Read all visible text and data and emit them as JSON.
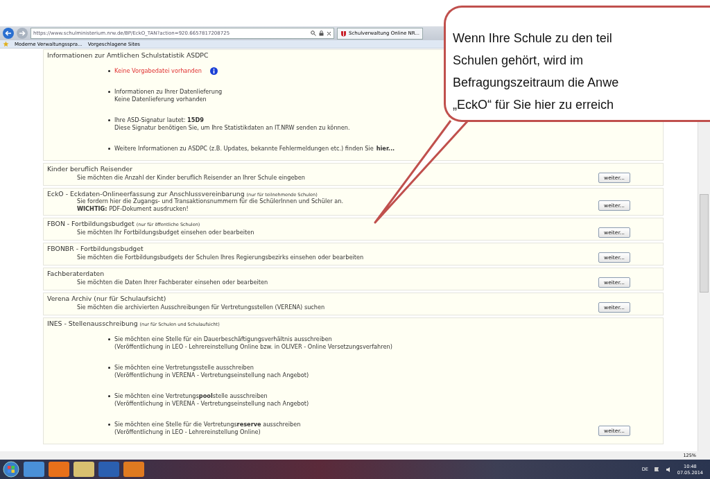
{
  "browser": {
    "url": "https://www.schulministerium.nrw.de/BP/EckO_TAN?action=920.6657817208725",
    "tab": "Schulverwaltung Online NR...",
    "favorites": [
      "Moderne Verwaltungsspra...",
      "Vorgeschlagene Sites"
    ]
  },
  "sections": [
    {
      "title": "Informationen zur Amtlichen Schulstatistik ASDPC",
      "bullets": [
        {
          "kind": "alert",
          "lines": [
            "Keine Vorgabedatei vorhanden"
          ]
        },
        {
          "kind": "text",
          "lines": [
            "Informationen zu Ihrer Datenlieferung",
            "Keine Datenlieferung vorhanden"
          ]
        },
        {
          "kind": "text",
          "lines": [
            "Ihre ASD-Signatur lautet: **15D9**",
            "Diese Signatur benötigen Sie, um Ihre Statistikdaten an IT.NRW senden zu können."
          ]
        },
        {
          "kind": "link",
          "lines": [
            "Weitere Informationen zu ASDPC (z.B. Updates, bekannte Fehlermeldungen etc.) finden Sie"
          ],
          "link": "hier..."
        }
      ]
    },
    {
      "title": "Kinder beruflich Reisender",
      "lines": [
        "Sie möchten die Anzahl der Kinder beruflich Reisender an Ihrer Schule eingeben"
      ],
      "button": "weiter..."
    },
    {
      "title": "EckO - Eckdaten-Onlineerfassung zur Anschlussvereinbarung",
      "note": "(nur für teilnehmende Schulen)",
      "lines": [
        "Sie fordern hier die Zugangs- und Transaktionsnummern für die SchülerInnen und Schüler an.",
        "**WICHTIG:** PDF-Dokument ausdrucken!"
      ],
      "button": "weiter..."
    },
    {
      "title": "FBON - Fortbildungsbudget",
      "note": "(nur für öffentliche Schulen)",
      "lines": [
        "Sie möchten Ihr Fortbildungsbudget einsehen oder bearbeiten"
      ],
      "button": "weiter..."
    },
    {
      "title": "FBONBR - Fortbildungsbudget",
      "lines": [
        "Sie möchten die Fortbildungsbudgets der Schulen Ihres Regierungsbezirks einsehen oder bearbeiten"
      ],
      "button": "weiter..."
    },
    {
      "title": "Fachberaterdaten",
      "lines": [
        "Sie möchten die Daten Ihrer Fachberater einsehen oder bearbeiten"
      ],
      "button": "weiter..."
    },
    {
      "title": "Verena Archiv (nur für Schulaufsicht)",
      "lines": [
        "Sie möchten die archivierten Ausschreibungen für Vertretungsstellen (VERENA) suchen"
      ],
      "button": "weiter..."
    },
    {
      "title": "INES - Stellenausschreibung",
      "note": "(nur für Schulen und Schulaufsicht)",
      "bullets": [
        {
          "kind": "text",
          "lines": [
            "Sie möchten eine Stelle für ein Dauerbeschäftigungsverhältnis ausschreiben",
            "(Veröffentlichung in LEO - Lehrereinstellung Online bzw. in OLIVER - Online Versetzungsverfahren)"
          ]
        },
        {
          "kind": "text",
          "lines": [
            "Sie möchten eine Vertretungsstelle ausschreiben",
            "(Veröffentlichung in VERENA - Vertretungseinstellung nach Angebot)"
          ]
        },
        {
          "kind": "text",
          "lines": [
            "Sie möchten eine Vertretungs**pool**stelle ausschreiben",
            "(Veröffentlichung in VERENA - Vertretungseinstellung nach Angebot)"
          ]
        },
        {
          "kind": "text",
          "lines": [
            "Sie möchten eine Stelle für die Vertretungs**reserve** ausschreiben",
            "(Veröffentlichung in LEO - Lehrereinstellung Online)"
          ]
        }
      ],
      "button": "weiter..."
    }
  ],
  "status_bar": {
    "zoom": "125%"
  },
  "taskbar": {
    "language": "DE",
    "time": "10:48",
    "date": "07.05.2014"
  },
  "callout": {
    "lines": [
      "Wenn Ihre Schule zu den teil",
      "Schulen gehört, wird im",
      "Befragungszeitraum die Anwe",
      "„EckO“ für Sie hier zu erreich"
    ]
  }
}
